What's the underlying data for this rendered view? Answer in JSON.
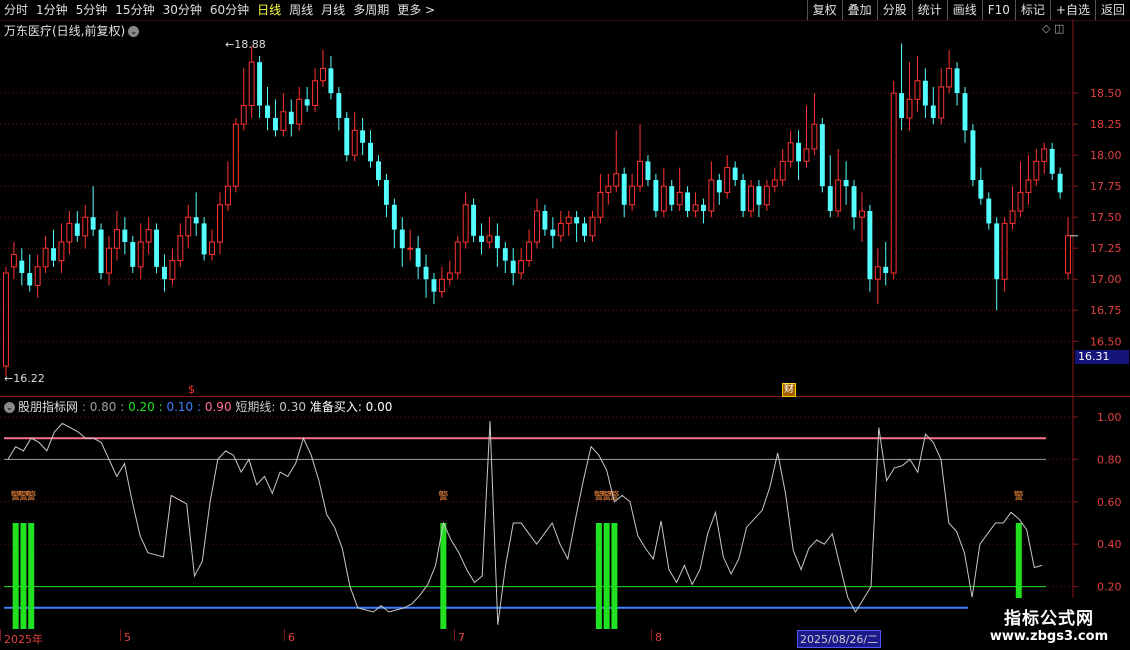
{
  "toolbar": {
    "periods": [
      "分时",
      "1分钟",
      "5分钟",
      "15分钟",
      "30分钟",
      "60分钟",
      "日线",
      "周线",
      "月线",
      "多周期",
      "更多 >"
    ],
    "active_period": "日线",
    "buttons": [
      "复权",
      "叠加",
      "分股",
      "统计",
      "画线",
      "F10",
      "标记",
      "+自选",
      "返回"
    ]
  },
  "chart_title": "万东医疗(日线,前复权)",
  "price_axis": {
    "labels": [
      "18.50",
      "18.25",
      "18.00",
      "17.75",
      "17.50",
      "17.25",
      "17.00",
      "16.75",
      "16.50"
    ],
    "current_price_tag": "16.31"
  },
  "annotations": {
    "high_label": "←18.88",
    "low_label": "←16.22",
    "finance_badge": "财",
    "dollar_mark": "$"
  },
  "indicator": {
    "name": "股朋指标网",
    "values": [
      {
        "label": "0.80",
        "color": "#9aa0a0"
      },
      {
        "label": "0.20",
        "color": "#20e020"
      },
      {
        "label": "0.10",
        "color": "#4080ff"
      },
      {
        "label": "0.90",
        "color": "#ff7090"
      }
    ],
    "short_line": "短期线: 0.30",
    "ready_buy": "准备买入: 0.00",
    "axis_labels": [
      "1.00",
      "0.80",
      "0.60",
      "0.40",
      "0.20"
    ],
    "signal_label": "警"
  },
  "date_axis": {
    "ticks": [
      {
        "label": "2025年"
      },
      {
        "label": "5"
      },
      {
        "label": "6"
      },
      {
        "label": "7"
      },
      {
        "label": "8"
      }
    ],
    "cursor_date": "2025/08/26/二"
  },
  "watermark": {
    "line1": "指标公式网",
    "line2": "www.zbgs3.com"
  },
  "chart_data": {
    "type": "candlestick",
    "title": "万东医疗(日线,前复权)",
    "ylim": [
      16.22,
      18.88
    ],
    "up_color": "#ff3232",
    "down_color": "#54ffff",
    "candles": [
      {
        "o": 16.3,
        "c": 17.05,
        "h": 17.1,
        "l": 16.22
      },
      {
        "o": 17.1,
        "c": 17.2,
        "h": 17.3,
        "l": 17.0
      },
      {
        "o": 17.15,
        "c": 17.05,
        "h": 17.25,
        "l": 16.95
      },
      {
        "o": 17.05,
        "c": 16.95,
        "h": 17.2,
        "l": 16.9
      },
      {
        "o": 16.95,
        "c": 17.1,
        "h": 17.2,
        "l": 16.85
      },
      {
        "o": 17.1,
        "c": 17.25,
        "h": 17.35,
        "l": 17.05
      },
      {
        "o": 17.25,
        "c": 17.15,
        "h": 17.4,
        "l": 17.1
      },
      {
        "o": 17.15,
        "c": 17.3,
        "h": 17.45,
        "l": 17.05
      },
      {
        "o": 17.3,
        "c": 17.45,
        "h": 17.55,
        "l": 17.2
      },
      {
        "o": 17.45,
        "c": 17.35,
        "h": 17.55,
        "l": 17.3
      },
      {
        "o": 17.35,
        "c": 17.5,
        "h": 17.6,
        "l": 17.25
      },
      {
        "o": 17.5,
        "c": 17.4,
        "h": 17.75,
        "l": 17.35
      },
      {
        "o": 17.4,
        "c": 17.05,
        "h": 17.45,
        "l": 17.0
      },
      {
        "o": 17.05,
        "c": 17.25,
        "h": 17.35,
        "l": 16.95
      },
      {
        "o": 17.25,
        "c": 17.4,
        "h": 17.55,
        "l": 17.15
      },
      {
        "o": 17.4,
        "c": 17.3,
        "h": 17.5,
        "l": 17.2
      },
      {
        "o": 17.3,
        "c": 17.1,
        "h": 17.35,
        "l": 17.05
      },
      {
        "o": 17.1,
        "c": 17.3,
        "h": 17.45,
        "l": 17.0
      },
      {
        "o": 17.3,
        "c": 17.4,
        "h": 17.5,
        "l": 17.2
      },
      {
        "o": 17.4,
        "c": 17.1,
        "h": 17.45,
        "l": 17.05
      },
      {
        "o": 17.1,
        "c": 17.0,
        "h": 17.2,
        "l": 16.9
      },
      {
        "o": 17.0,
        "c": 17.15,
        "h": 17.25,
        "l": 16.95
      },
      {
        "o": 17.15,
        "c": 17.35,
        "h": 17.45,
        "l": 17.1
      },
      {
        "o": 17.35,
        "c": 17.5,
        "h": 17.6,
        "l": 17.25
      },
      {
        "o": 17.5,
        "c": 17.45,
        "h": 17.7,
        "l": 17.35
      },
      {
        "o": 17.45,
        "c": 17.2,
        "h": 17.5,
        "l": 17.15
      },
      {
        "o": 17.2,
        "c": 17.3,
        "h": 17.4,
        "l": 17.15
      },
      {
        "o": 17.3,
        "c": 17.6,
        "h": 17.7,
        "l": 17.2
      },
      {
        "o": 17.6,
        "c": 17.75,
        "h": 17.95,
        "l": 17.55
      },
      {
        "o": 17.75,
        "c": 18.25,
        "h": 18.3,
        "l": 17.7
      },
      {
        "o": 18.25,
        "c": 18.4,
        "h": 18.7,
        "l": 18.2
      },
      {
        "o": 18.4,
        "c": 18.75,
        "h": 18.88,
        "l": 18.3
      },
      {
        "o": 18.75,
        "c": 18.4,
        "h": 18.8,
        "l": 18.3
      },
      {
        "o": 18.4,
        "c": 18.3,
        "h": 18.55,
        "l": 18.2
      },
      {
        "o": 18.3,
        "c": 18.2,
        "h": 18.45,
        "l": 18.15
      },
      {
        "o": 18.2,
        "c": 18.35,
        "h": 18.5,
        "l": 18.15
      },
      {
        "o": 18.35,
        "c": 18.25,
        "h": 18.45,
        "l": 18.15
      },
      {
        "o": 18.25,
        "c": 18.45,
        "h": 18.55,
        "l": 18.2
      },
      {
        "o": 18.45,
        "c": 18.4,
        "h": 18.55,
        "l": 18.35
      },
      {
        "o": 18.4,
        "c": 18.6,
        "h": 18.7,
        "l": 18.35
      },
      {
        "o": 18.6,
        "c": 18.7,
        "h": 18.85,
        "l": 18.55
      },
      {
        "o": 18.7,
        "c": 18.5,
        "h": 18.8,
        "l": 18.45
      },
      {
        "o": 18.5,
        "c": 18.3,
        "h": 18.55,
        "l": 18.2
      },
      {
        "o": 18.3,
        "c": 18.0,
        "h": 18.35,
        "l": 17.95
      },
      {
        "o": 18.0,
        "c": 18.2,
        "h": 18.35,
        "l": 17.95
      },
      {
        "o": 18.2,
        "c": 18.1,
        "h": 18.3,
        "l": 18.0
      },
      {
        "o": 18.1,
        "c": 17.95,
        "h": 18.2,
        "l": 17.9
      },
      {
        "o": 17.95,
        "c": 17.8,
        "h": 18.0,
        "l": 17.75
      },
      {
        "o": 17.8,
        "c": 17.6,
        "h": 17.85,
        "l": 17.5
      },
      {
        "o": 17.6,
        "c": 17.4,
        "h": 17.65,
        "l": 17.25
      },
      {
        "o": 17.4,
        "c": 17.25,
        "h": 17.5,
        "l": 17.1
      },
      {
        "o": 17.25,
        "c": 17.25,
        "h": 17.4,
        "l": 17.15
      },
      {
        "o": 17.25,
        "c": 17.1,
        "h": 17.35,
        "l": 17.0
      },
      {
        "o": 17.1,
        "c": 17.0,
        "h": 17.2,
        "l": 16.85
      },
      {
        "o": 17.0,
        "c": 16.9,
        "h": 17.05,
        "l": 16.8
      },
      {
        "o": 16.9,
        "c": 17.0,
        "h": 17.1,
        "l": 16.85
      },
      {
        "o": 17.0,
        "c": 17.05,
        "h": 17.15,
        "l": 16.95
      },
      {
        "o": 17.05,
        "c": 17.3,
        "h": 17.35,
        "l": 17.0
      },
      {
        "o": 17.3,
        "c": 17.6,
        "h": 17.7,
        "l": 17.25
      },
      {
        "o": 17.6,
        "c": 17.35,
        "h": 17.65,
        "l": 17.3
      },
      {
        "o": 17.35,
        "c": 17.3,
        "h": 17.45,
        "l": 17.2
      },
      {
        "o": 17.3,
        "c": 17.35,
        "h": 17.5,
        "l": 17.25
      },
      {
        "o": 17.35,
        "c": 17.25,
        "h": 17.45,
        "l": 17.1
      },
      {
        "o": 17.25,
        "c": 17.15,
        "h": 17.3,
        "l": 17.05
      },
      {
        "o": 17.15,
        "c": 17.05,
        "h": 17.25,
        "l": 16.95
      },
      {
        "o": 17.05,
        "c": 17.15,
        "h": 17.25,
        "l": 17.0
      },
      {
        "o": 17.15,
        "c": 17.3,
        "h": 17.4,
        "l": 17.1
      },
      {
        "o": 17.3,
        "c": 17.55,
        "h": 17.65,
        "l": 17.25
      },
      {
        "o": 17.55,
        "c": 17.4,
        "h": 17.6,
        "l": 17.35
      },
      {
        "o": 17.4,
        "c": 17.35,
        "h": 17.5,
        "l": 17.25
      },
      {
        "o": 17.35,
        "c": 17.45,
        "h": 17.55,
        "l": 17.3
      },
      {
        "o": 17.45,
        "c": 17.5,
        "h": 17.55,
        "l": 17.35
      },
      {
        "o": 17.5,
        "c": 17.45,
        "h": 17.55,
        "l": 17.3
      },
      {
        "o": 17.45,
        "c": 17.35,
        "h": 17.5,
        "l": 17.3
      },
      {
        "o": 17.35,
        "c": 17.5,
        "h": 17.55,
        "l": 17.3
      },
      {
        "o": 17.5,
        "c": 17.7,
        "h": 17.85,
        "l": 17.45
      },
      {
        "o": 17.7,
        "c": 17.75,
        "h": 17.85,
        "l": 17.6
      },
      {
        "o": 17.75,
        "c": 17.85,
        "h": 18.2,
        "l": 17.7
      },
      {
        "o": 17.85,
        "c": 17.6,
        "h": 17.9,
        "l": 17.5
      },
      {
        "o": 17.6,
        "c": 17.75,
        "h": 17.85,
        "l": 17.55
      },
      {
        "o": 17.75,
        "c": 17.95,
        "h": 18.25,
        "l": 17.7
      },
      {
        "o": 17.95,
        "c": 17.8,
        "h": 18.0,
        "l": 17.75
      },
      {
        "o": 17.8,
        "c": 17.55,
        "h": 17.85,
        "l": 17.5
      },
      {
        "o": 17.55,
        "c": 17.75,
        "h": 17.9,
        "l": 17.5
      },
      {
        "o": 17.75,
        "c": 17.6,
        "h": 17.8,
        "l": 17.55
      },
      {
        "o": 17.6,
        "c": 17.7,
        "h": 17.9,
        "l": 17.55
      },
      {
        "o": 17.7,
        "c": 17.55,
        "h": 17.75,
        "l": 17.5
      },
      {
        "o": 17.55,
        "c": 17.6,
        "h": 17.7,
        "l": 17.5
      },
      {
        "o": 17.6,
        "c": 17.55,
        "h": 17.65,
        "l": 17.45
      },
      {
        "o": 17.55,
        "c": 17.8,
        "h": 17.95,
        "l": 17.5
      },
      {
        "o": 17.8,
        "c": 17.7,
        "h": 17.85,
        "l": 17.6
      },
      {
        "o": 17.7,
        "c": 17.9,
        "h": 18.0,
        "l": 17.65
      },
      {
        "o": 17.9,
        "c": 17.8,
        "h": 17.95,
        "l": 17.75
      },
      {
        "o": 17.8,
        "c": 17.55,
        "h": 17.85,
        "l": 17.5
      },
      {
        "o": 17.55,
        "c": 17.75,
        "h": 17.8,
        "l": 17.5
      },
      {
        "o": 17.75,
        "c": 17.6,
        "h": 17.8,
        "l": 17.5
      },
      {
        "o": 17.6,
        "c": 17.75,
        "h": 17.8,
        "l": 17.55
      },
      {
        "o": 17.75,
        "c": 17.8,
        "h": 17.9,
        "l": 17.7
      },
      {
        "o": 17.8,
        "c": 17.95,
        "h": 18.05,
        "l": 17.75
      },
      {
        "o": 17.95,
        "c": 18.1,
        "h": 18.2,
        "l": 17.9
      },
      {
        "o": 18.1,
        "c": 17.95,
        "h": 18.2,
        "l": 17.8
      },
      {
        "o": 17.95,
        "c": 18.05,
        "h": 18.4,
        "l": 17.9
      },
      {
        "o": 18.05,
        "c": 18.25,
        "h": 18.5,
        "l": 18.0
      },
      {
        "o": 18.25,
        "c": 17.75,
        "h": 18.3,
        "l": 17.7
      },
      {
        "o": 17.75,
        "c": 17.55,
        "h": 18.0,
        "l": 17.5
      },
      {
        "o": 17.55,
        "c": 17.8,
        "h": 18.05,
        "l": 17.5
      },
      {
        "o": 17.8,
        "c": 17.75,
        "h": 17.95,
        "l": 17.6
      },
      {
        "o": 17.75,
        "c": 17.5,
        "h": 17.8,
        "l": 17.4
      },
      {
        "o": 17.5,
        "c": 17.55,
        "h": 17.7,
        "l": 17.3
      },
      {
        "o": 17.55,
        "c": 17.0,
        "h": 17.6,
        "l": 16.9
      },
      {
        "o": 17.0,
        "c": 17.1,
        "h": 17.25,
        "l": 16.8
      },
      {
        "o": 17.1,
        "c": 17.05,
        "h": 17.3,
        "l": 16.95
      },
      {
        "o": 17.05,
        "c": 18.5,
        "h": 18.6,
        "l": 17.0
      },
      {
        "o": 18.5,
        "c": 18.3,
        "h": 18.9,
        "l": 18.2
      },
      {
        "o": 18.3,
        "c": 18.45,
        "h": 18.75,
        "l": 18.2
      },
      {
        "o": 18.45,
        "c": 18.6,
        "h": 18.8,
        "l": 18.35
      },
      {
        "o": 18.6,
        "c": 18.4,
        "h": 18.7,
        "l": 18.3
      },
      {
        "o": 18.4,
        "c": 18.3,
        "h": 18.55,
        "l": 18.25
      },
      {
        "o": 18.3,
        "c": 18.55,
        "h": 18.7,
        "l": 18.25
      },
      {
        "o": 18.55,
        "c": 18.7,
        "h": 18.85,
        "l": 18.5
      },
      {
        "o": 18.7,
        "c": 18.5,
        "h": 18.75,
        "l": 18.4
      },
      {
        "o": 18.5,
        "c": 18.2,
        "h": 18.55,
        "l": 18.1
      },
      {
        "o": 18.2,
        "c": 17.8,
        "h": 18.25,
        "l": 17.75
      },
      {
        "o": 17.8,
        "c": 17.65,
        "h": 17.9,
        "l": 17.6
      },
      {
        "o": 17.65,
        "c": 17.45,
        "h": 17.7,
        "l": 17.4
      },
      {
        "o": 17.45,
        "c": 17.0,
        "h": 17.5,
        "l": 16.75
      },
      {
        "o": 17.0,
        "c": 17.45,
        "h": 17.5,
        "l": 16.9
      },
      {
        "o": 17.45,
        "c": 17.55,
        "h": 17.75,
        "l": 17.4
      },
      {
        "o": 17.55,
        "c": 17.7,
        "h": 17.95,
        "l": 17.5
      },
      {
        "o": 17.7,
        "c": 17.8,
        "h": 18.0,
        "l": 17.6
      },
      {
        "o": 17.8,
        "c": 17.95,
        "h": 18.05,
        "l": 17.75
      },
      {
        "o": 17.95,
        "c": 18.05,
        "h": 18.1,
        "l": 17.85
      },
      {
        "o": 18.05,
        "c": 17.85,
        "h": 18.1,
        "l": 17.8
      },
      {
        "o": 17.85,
        "c": 17.7,
        "h": 17.9,
        "l": 17.65
      },
      {
        "o": 17.05,
        "c": 17.35,
        "h": 17.5,
        "l": 17.0
      }
    ],
    "indicator_series": [
      {
        "name": "短期线",
        "color": "#c8c8c8",
        "values": [
          0.8,
          0.86,
          0.84,
          0.9,
          0.88,
          0.84,
          0.93,
          0.97,
          0.95,
          0.93,
          0.9,
          0.9,
          0.88,
          0.8,
          0.72,
          0.78,
          0.6,
          0.44,
          0.36,
          0.35,
          0.34,
          0.63,
          0.61,
          0.59,
          0.25,
          0.32,
          0.6,
          0.8,
          0.84,
          0.82,
          0.74,
          0.8,
          0.68,
          0.72,
          0.64,
          0.74,
          0.72,
          0.78,
          0.9,
          0.82,
          0.7,
          0.54,
          0.48,
          0.38,
          0.2,
          0.1,
          0.09,
          0.08,
          0.11,
          0.08,
          0.09,
          0.1,
          0.12,
          0.16,
          0.21,
          0.3,
          0.5,
          0.42,
          0.36,
          0.28,
          0.22,
          0.25,
          0.98,
          0.02,
          0.3,
          0.5,
          0.5,
          0.45,
          0.4,
          0.45,
          0.5,
          0.4,
          0.33,
          0.52,
          0.7,
          0.86,
          0.82,
          0.75,
          0.6,
          0.63,
          0.6,
          0.44,
          0.38,
          0.33,
          0.51,
          0.28,
          0.22,
          0.3,
          0.21,
          0.28,
          0.45,
          0.55,
          0.34,
          0.26,
          0.33,
          0.48,
          0.52,
          0.56,
          0.67,
          0.83,
          0.64,
          0.37,
          0.28,
          0.38,
          0.42,
          0.4,
          0.45,
          0.3,
          0.15,
          0.08,
          0.14,
          0.2,
          0.95,
          0.7,
          0.76,
          0.77,
          0.8,
          0.74,
          0.92,
          0.88,
          0.8,
          0.5,
          0.46,
          0.36,
          0.15,
          0.4,
          0.45,
          0.5,
          0.5,
          0.55,
          0.52,
          0.47,
          0.29,
          0.3
        ]
      }
    ],
    "indicator_levels": [
      {
        "value": 0.9,
        "color": "#ff7090"
      },
      {
        "value": 0.8,
        "color": "#9aa0a0"
      },
      {
        "value": 0.2,
        "color": "#20e020"
      },
      {
        "value": 0.1,
        "color": "#4080ff"
      }
    ],
    "buy_signal_bars": [
      {
        "index": 1,
        "value": 0.5
      },
      {
        "index": 2,
        "value": 0.5
      },
      {
        "index": 3,
        "value": 0.5
      },
      {
        "index": 56,
        "value": 0.5
      },
      {
        "index": 76,
        "value": 0.5
      },
      {
        "index": 77,
        "value": 0.5
      },
      {
        "index": 78,
        "value": 0.5
      },
      {
        "index": 130,
        "value": 0.5
      }
    ],
    "indicator_ylim": [
      0,
      1.0
    ]
  }
}
